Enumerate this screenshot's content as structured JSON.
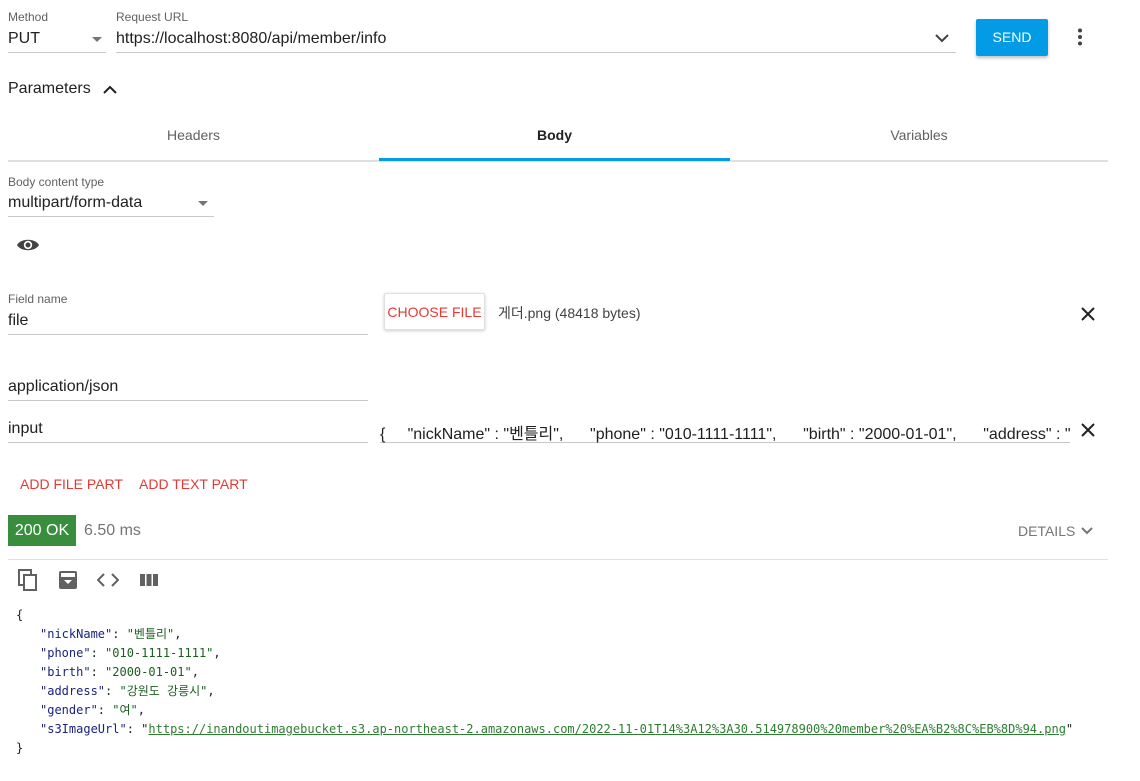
{
  "request": {
    "method_label": "Method",
    "method": "PUT",
    "url_label": "Request URL",
    "url": "https://localhost:8080/api/member/info",
    "send_label": "SEND"
  },
  "parameters": {
    "title": "Parameters"
  },
  "tabs": [
    {
      "label": "Headers"
    },
    {
      "label": "Body"
    },
    {
      "label": "Variables"
    }
  ],
  "body": {
    "content_type_label": "Body content type",
    "content_type": "multipart/form-data",
    "parts": [
      {
        "field_name_label": "Field name",
        "field_name": "file",
        "choose_label": "CHOOSE FILE",
        "file_info": "게더.png (48418 bytes)"
      },
      {
        "content_type": "application/json",
        "field_name": "input",
        "value": "{     \"nickName\" : \"벤틀리\",      \"phone\" : \"010-1111-1111\",      \"birth\" : \"2000-01-01\",      \"address\" : \"강원도 강릉시\",      \"gender\" : \"여\" }"
      }
    ],
    "add_file_label": "ADD FILE PART",
    "add_text_label": "ADD TEXT PART"
  },
  "response": {
    "status": "200 OK",
    "time": "6.50 ms",
    "details_label": "DETAILS",
    "json_lines": [
      {
        "indent": false,
        "key": "",
        "value": "{",
        "link": false,
        "comma": false
      },
      {
        "indent": true,
        "key": "\"nickName\"",
        "value": "\"벤틀리\"",
        "link": false,
        "comma": true
      },
      {
        "indent": true,
        "key": "\"phone\"",
        "value": "\"010-1111-1111\"",
        "link": false,
        "comma": true
      },
      {
        "indent": true,
        "key": "\"birth\"",
        "value": "\"2000-01-01\"",
        "link": false,
        "comma": true
      },
      {
        "indent": true,
        "key": "\"address\"",
        "value": "\"강원도 강릉시\"",
        "link": false,
        "comma": true
      },
      {
        "indent": true,
        "key": "\"gender\"",
        "value": "\"여\"",
        "link": false,
        "comma": true
      },
      {
        "indent": true,
        "key": "\"s3ImageUrl\"",
        "value": "https://inandoutimagebucket.s3.ap-northeast-2.amazonaws.com/2022-11-01T14%3A12%3A30.514978900%20member%20%EA%B2%8C%EB%8D%94.png",
        "link": true,
        "comma": false
      },
      {
        "indent": false,
        "key": "",
        "value": "}",
        "link": false,
        "comma": false
      }
    ]
  },
  "icons": {
    "method_dropdown": "caret-down-icon",
    "url_dropdown": "chevron-down-icon",
    "more": "more-vert-icon",
    "params_toggle": "chevron-up-icon",
    "content_type_dropdown": "caret-down-icon",
    "preview": "eye-icon",
    "remove_part": "close-icon",
    "details": "chevron-down-icon",
    "copy": "copy-icon",
    "save": "download-icon",
    "code": "code-icon",
    "columns": "columns-icon"
  },
  "colors": {
    "accent": "#039be5",
    "status_ok": "#388e3c",
    "link_action": "#e53935"
  }
}
